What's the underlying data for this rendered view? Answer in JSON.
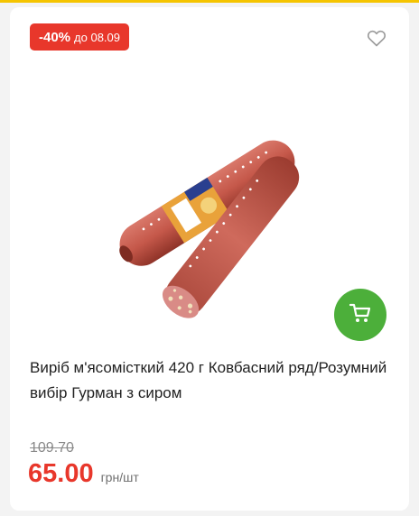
{
  "badge": {
    "discount": "-40%",
    "until": "до 08.09"
  },
  "product": {
    "title": "Виріб м'ясомісткий 420 г Ковбасний ряд/Розумний вибір Гурман з сиром",
    "image_alt": "sausage-product-image"
  },
  "price": {
    "old": "109.70",
    "current": "65.00",
    "unit": "грн/шт"
  },
  "icons": {
    "favorite": "heart-outline-icon",
    "cart": "shopping-cart-icon"
  },
  "colors": {
    "accent_red": "#e8372b",
    "cart_green": "#4caf3a",
    "top_yellow": "#f5c400"
  }
}
